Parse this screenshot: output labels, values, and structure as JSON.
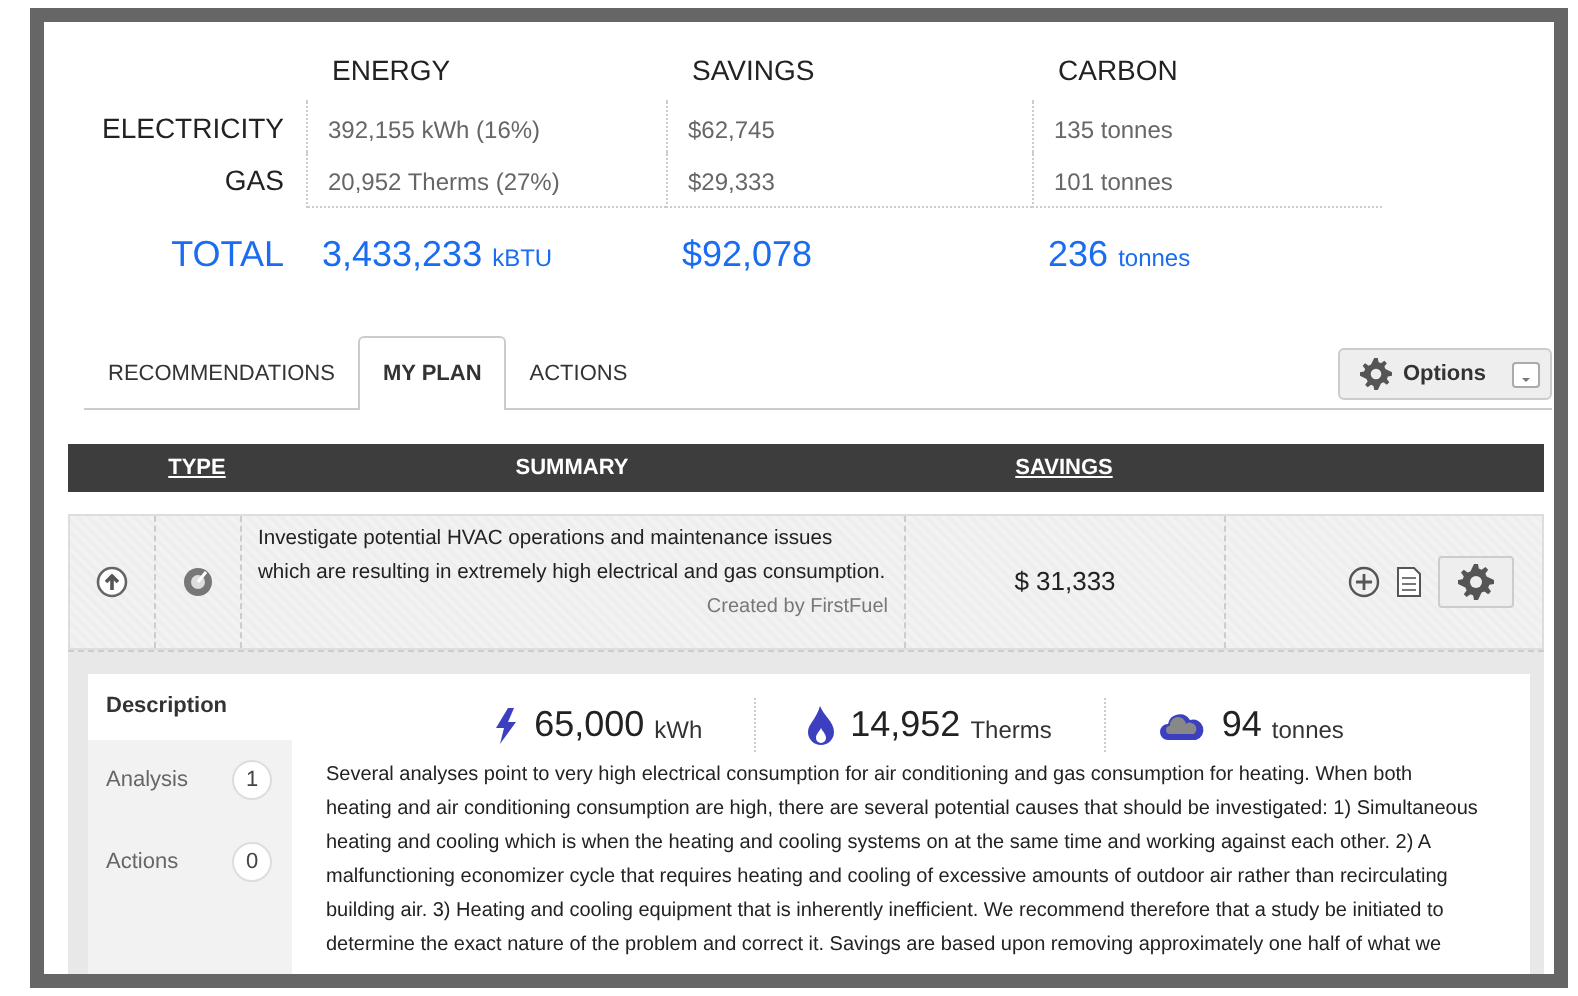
{
  "summary": {
    "columns": [
      "ENERGY",
      "SAVINGS",
      "CARBON"
    ],
    "rows": [
      {
        "label": "ELECTRICITY",
        "cells": [
          "392,155 kWh (16%)",
          "$62,745",
          "135 tonnes"
        ]
      },
      {
        "label": "GAS",
        "cells": [
          "20,952 Therms (27%)",
          "$29,333",
          "101 tonnes"
        ]
      }
    ],
    "total": {
      "label": "TOTAL",
      "cells": [
        {
          "value": "3,433,233",
          "unit": "kBTU"
        },
        {
          "value": "$92,078"
        },
        {
          "value": "236",
          "unit": "tonnes"
        }
      ]
    }
  },
  "tabs": [
    {
      "label": "RECOMMENDATIONS",
      "selected": false
    },
    {
      "label": "MY PLAN",
      "selected": true
    },
    {
      "label": "ACTIONS",
      "selected": false
    }
  ],
  "options_button": {
    "label": "Options"
  },
  "table": {
    "columns": [
      {
        "label": "TYPE",
        "sortable": true
      },
      {
        "label": "SUMMARY",
        "sortable": false
      },
      {
        "label": "SAVINGS",
        "sortable": true
      }
    ],
    "rows": [
      {
        "summary": "Investigate potential HVAC operations and maintenance issues which are resulting in extremely high electrical and gas consumption.",
        "created_by": "Created by FirstFuel",
        "savings": "$ 31,333"
      }
    ]
  },
  "detail": {
    "tabs": [
      {
        "label": "Description",
        "selected": true
      },
      {
        "label": "Analysis",
        "count": "1",
        "selected": false
      },
      {
        "label": "Actions",
        "count": "0",
        "selected": false
      }
    ],
    "metrics": [
      {
        "kind": "electricity",
        "value": "65,000",
        "unit": "kWh"
      },
      {
        "kind": "gas",
        "value": "14,952",
        "unit": "Therms"
      },
      {
        "kind": "carbon",
        "value": "94",
        "unit": "tonnes"
      }
    ],
    "description": "Several analyses point to very high electrical consumption for air conditioning and gas consumption for heating. When both heating and air conditioning consumption are high, there are several potential causes that should be investigated: 1) Simultaneous heating and cooling which is when the heating and cooling systems on at the same time and working against each other. 2) A malfunctioning economizer cycle that requires heating and cooling of excessive amounts of outdoor air rather than recirculating building air. 3) Heating and cooling equipment that is inherently inefficient. We recommend therefore that a study be initiated to determine the exact nature of the problem and correct it. Savings are based upon removing approximately one half of what we"
  }
}
